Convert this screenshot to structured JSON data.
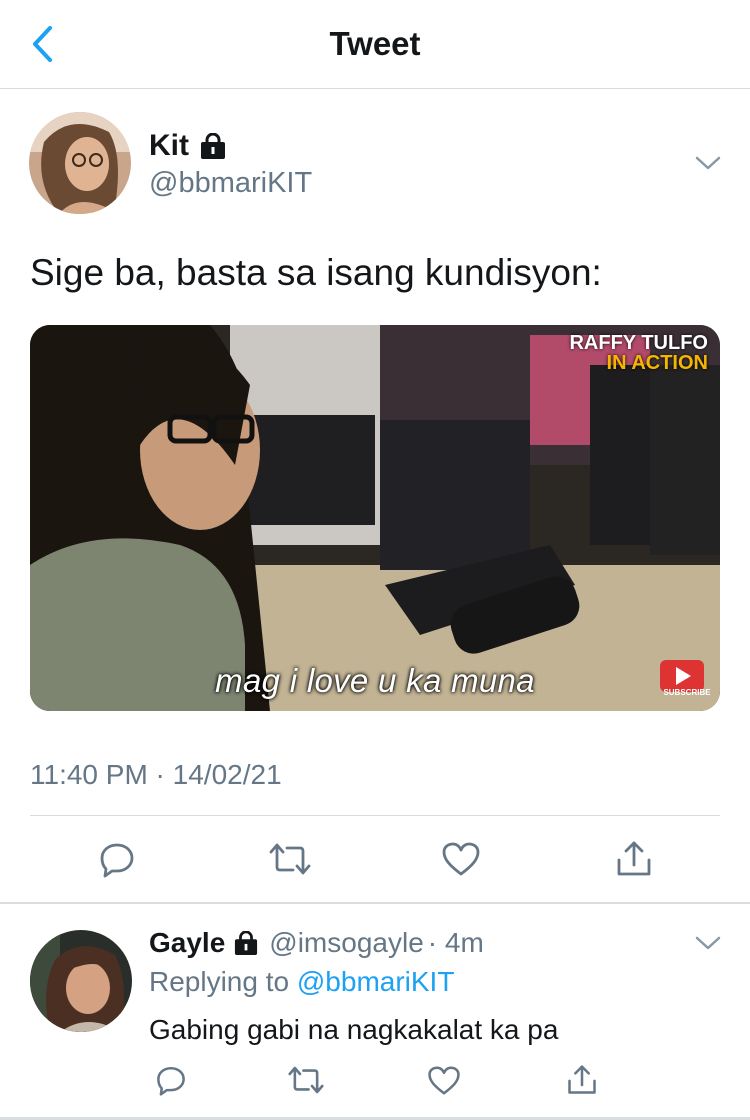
{
  "header": {
    "title": "Tweet",
    "back_icon": "chevron-left-icon"
  },
  "tweet": {
    "author_name": "Kit",
    "author_handle": "@bbmariKIT",
    "text": "Sige ba, basta sa isang kundisyon:",
    "media": {
      "caption": "mag i love u ka muna",
      "brand_line1": "RAFFY TULFO",
      "brand_line2": "IN ACTION",
      "subscribe_label": "SUBSCRIBE"
    },
    "timestamp": "11:40 PM · 14/02/21",
    "actions": [
      "reply-icon",
      "retweet-icon",
      "like-icon",
      "share-icon"
    ]
  },
  "reply": {
    "author_name": "Gayle",
    "author_handle": "@imsogayle",
    "time": "· 4m",
    "replying_prefix": "Replying to",
    "replying_to": "@bbmariKIT",
    "text": "Gabing gabi na nagkakalat ka pa",
    "actions": [
      "reply-icon",
      "retweet-icon",
      "like-icon",
      "share-icon"
    ]
  },
  "colors": {
    "accent": "#1da1f2",
    "secondary_text": "#657786",
    "divider": "#d8dde1"
  }
}
